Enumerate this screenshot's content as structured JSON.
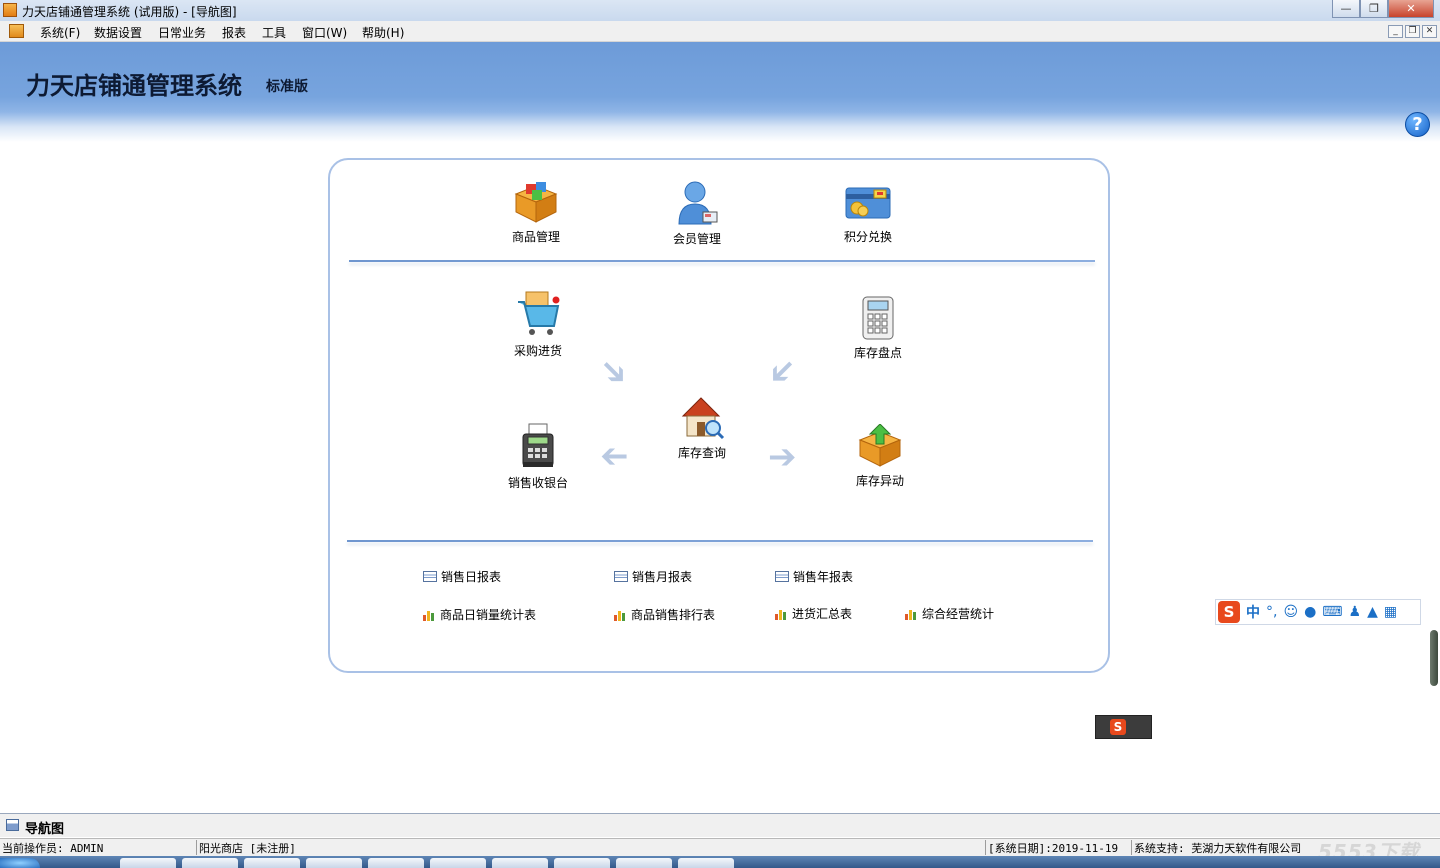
{
  "window": {
    "title": "力天店铺通管理系统 (试用版) - [导航图]"
  },
  "menu": [
    "系统(F)",
    "数据设置",
    "日常业务",
    "报表",
    "工具",
    "窗口(W)",
    "帮助(H)"
  ],
  "banner": {
    "name": "力天店铺通管理系统",
    "edition": "标准版"
  },
  "tiles": {
    "goods": "商品管理",
    "members": "会员管理",
    "points": "积分兑换",
    "purchase": "采购进货",
    "stocktake": "库存盘点",
    "query": "库存查询",
    "cashier": "销售收银台",
    "change": "库存异动"
  },
  "reports": {
    "daily": "销售日报表",
    "monthly": "销售月报表",
    "yearly": "销售年报表",
    "goods_daily": "商品日销量统计表",
    "goods_rank": "商品销售排行表",
    "purchase_summary": "进货汇总表",
    "overall": "综合经营统计"
  },
  "ime": {
    "mode": "中",
    "punct": "°,"
  },
  "navtab": {
    "label": "导航图"
  },
  "status": {
    "operator": "当前操作员: ADMIN",
    "shop": "阳光商店 [未注册]",
    "date": "[系统日期]:2019-11-19",
    "support": "系统支持: 芜湖力天软件有限公司"
  },
  "watermark": "5553下载"
}
